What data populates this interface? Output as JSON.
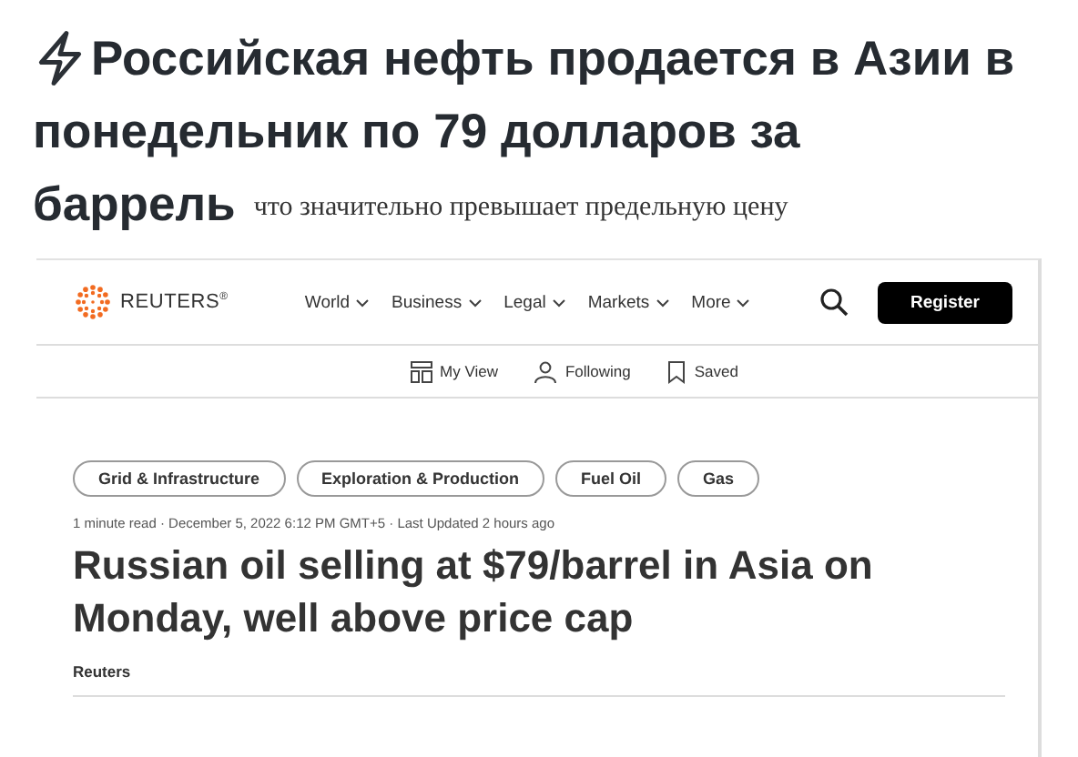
{
  "post": {
    "headline_lines": [
      "Российская нефть продается в Азии в",
      "понедельник по 79 долларов за",
      "баррель"
    ],
    "subtitle": "что значительно превышает предельную цену"
  },
  "page": {
    "logo": "REUTERS$^{®}$",
    "nav": [
      {
        "label": "World"
      },
      {
        "label": "Business"
      },
      {
        "label": "Legal"
      },
      {
        "label": "Markets"
      },
      {
        "label": "More"
      }
    ],
    "register": "Register",
    "subnav": [
      {
        "label": "My View",
        "kind": "layout"
      },
      {
        "label": "Following",
        "kind": "person"
      },
      {
        "label": "Saved",
        "kind": "bookmark"
      }
    ],
    "tags": [
      "Grid & Infrastructure",
      "Exploration & Production",
      "Fuel Oil",
      "Gas"
    ],
    "meta": "1 minute read · December 5, 2022 6:12 PM GMT+5 · Last Updated 2 hours ago",
    "title": "Russian oil selling at $79/barrel in Asia on Monday, well above price cap",
    "author": "Reuters"
  }
}
